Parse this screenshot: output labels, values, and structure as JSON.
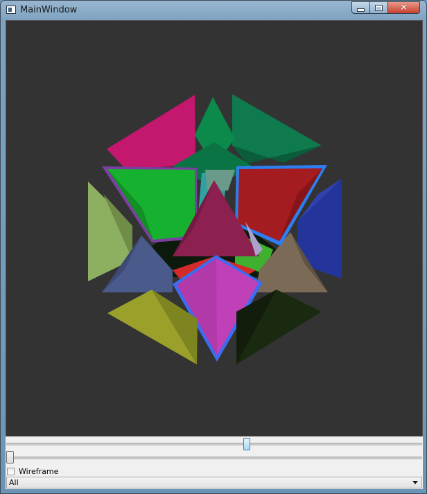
{
  "window": {
    "title": "MainWindow"
  },
  "controls": {
    "wireframe_label": "Wireframe",
    "wireframe_checked": false,
    "filter_selected": "All"
  },
  "scene": {
    "background": "#333333",
    "shape_colors": [
      "#c4176e",
      "#0e7a4e",
      "#0b8a4c",
      "#16b12e",
      "#a41c20",
      "#8c2150",
      "#2d7ff0",
      "#7a3fa0",
      "#7e9e4c",
      "#23359a",
      "#4a5a8a",
      "#7a6a56",
      "#c040b8",
      "#9aa02a",
      "#1a2a10",
      "#b0b0d0",
      "#d42a2a",
      "#40b030",
      "#30c0c0"
    ]
  }
}
